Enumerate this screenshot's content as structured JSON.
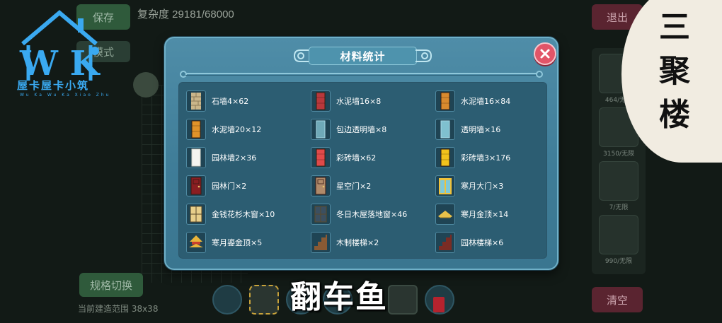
{
  "background": {
    "save_label": "保存",
    "mode_label": "模式",
    "complexity_label": "复杂度 29181/68000",
    "exit_label": "退出",
    "switch_label": "规格切换",
    "clear_label": "清空",
    "size_label": "当前建造范围 38x38",
    "slot_labels": [
      "464/无限",
      "3150/无限",
      "7/无限",
      "990/无限"
    ]
  },
  "logo": {
    "letters": "W K",
    "title": "屋卡屋卡小筑",
    "subtitle": "Wu Ka Wu Ka Xiao Zhu"
  },
  "stamp": {
    "text": "三聚楼"
  },
  "dialog": {
    "title": "材料统计",
    "close_icon": "close-icon",
    "materials": [
      {
        "label": "石墙4×62",
        "icon": "stone-wall-icon",
        "color": "#c9b68a"
      },
      {
        "label": "水泥墙16×8",
        "icon": "cement-wall-icon",
        "color": "#b8383c"
      },
      {
        "label": "水泥墙16×84",
        "icon": "cement-wall-icon",
        "color": "#d98a2e"
      },
      {
        "label": "水泥墙20×12",
        "icon": "cement-wall-icon",
        "color": "#e0932a"
      },
      {
        "label": "包边透明墙×8",
        "icon": "glass-wall-icon",
        "color": "#6fa9b8"
      },
      {
        "label": "透明墙×16",
        "icon": "glass-wall-icon",
        "color": "#7fc0cf"
      },
      {
        "label": "园林墙2×36",
        "icon": "garden-wall-icon",
        "color": "#f4f4f0"
      },
      {
        "label": "彩砖墙×62",
        "icon": "brick-wall-icon",
        "color": "#e04a4a"
      },
      {
        "label": "彩砖墙3×176",
        "icon": "brick-wall-icon",
        "color": "#f2c21c"
      },
      {
        "label": "园林门×2",
        "icon": "door-icon",
        "color": "#8a1e22"
      },
      {
        "label": "星空门×2",
        "icon": "door-icon",
        "color": "#b08a6a"
      },
      {
        "label": "寒月大门×3",
        "icon": "gate-icon",
        "color": "#f0c23a"
      },
      {
        "label": "金钱花杉木窗×10",
        "icon": "window-icon",
        "color": "#e8cf8a"
      },
      {
        "label": "冬日木屋落地窗×46",
        "icon": "window-icon",
        "color": "#3b4f60"
      },
      {
        "label": "寒月金顶×14",
        "icon": "roof-icon",
        "color": "#e8c14a"
      },
      {
        "label": "寒月鎏金顶×5",
        "icon": "pavilion-roof-icon",
        "color": "#e8b43a"
      },
      {
        "label": "木制楼梯×2",
        "icon": "stairs-icon",
        "color": "#8a5a34"
      },
      {
        "label": "园林楼梯×6",
        "icon": "stairs-icon",
        "color": "#7a2c24"
      }
    ]
  },
  "caption": {
    "text": "翻车鱼"
  }
}
